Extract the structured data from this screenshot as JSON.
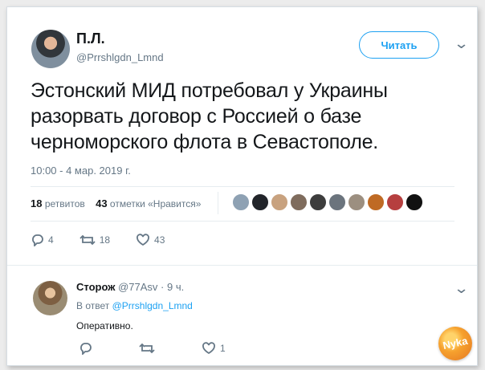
{
  "tweet": {
    "author_name": "П.Л.",
    "author_handle": "@Prrshlgdn_Lmnd",
    "follow_label": "Читать",
    "text": "Эстонский МИД потребовал у Украины разорвать договор с Россией о базе черноморского флота в Севастополе.",
    "timestamp": "10:00 - 4 мар. 2019 г.",
    "retweets": "18",
    "retweets_label": "ретвитов",
    "likes": "43",
    "likes_label": "отметки «Нравится»",
    "replies_count": "4",
    "retweet_count": "18",
    "like_count": "43"
  },
  "reply": {
    "author_name": "Сторож",
    "author_handle": "@77Asv",
    "time": "· 9 ч.",
    "in_reply_prefix": "В ответ",
    "in_reply_handle": "@Prrshlgdn_Lmnd",
    "text": "Оперативно.",
    "like_count": "1"
  },
  "watermark": {
    "text": "Nyka"
  },
  "colors": {
    "accent": "#1da1f2",
    "text": "#14171a",
    "muted": "#657786"
  },
  "icons": {
    "reply": "reply-icon",
    "retweet": "retweet-icon",
    "like": "heart-icon",
    "menu": "chevron-down-icon"
  }
}
